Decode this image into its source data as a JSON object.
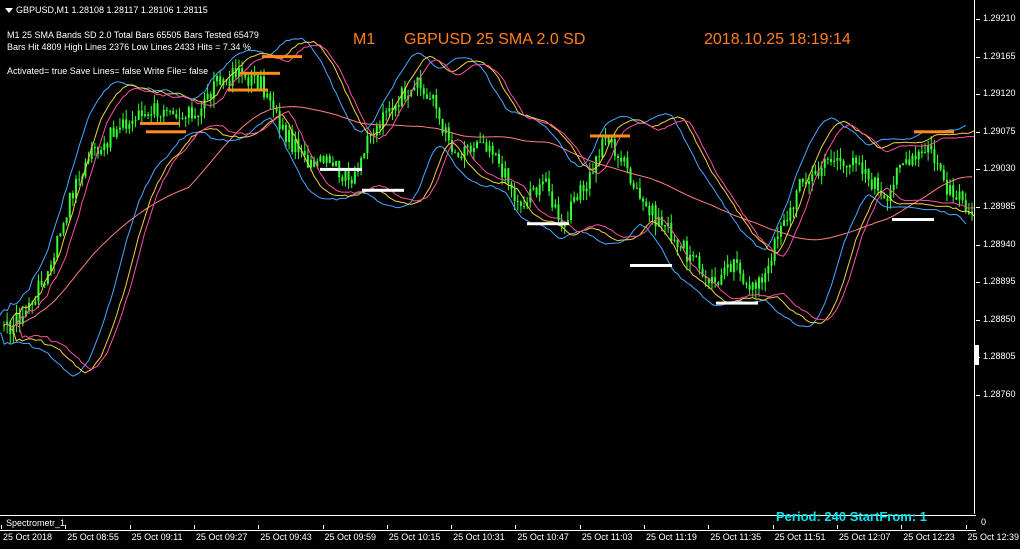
{
  "header": {
    "symbol_line": "GBPUSD,M1  1.28108 1.28117 1.28106 1.28115",
    "info_line1": "M1  25 SMA  Bands SD 2.0  Total Bars 65505  Bars Tested 65479",
    "info_line2": "Bars Hit 4809  High Lines 2376  Low Lines 2433  Hits = 7.34 %",
    "info_line3": "Activated= true  Save Lines= false  Write File= false",
    "banner_timeframe": "M1",
    "banner_title": "GBPUSD  25 SMA  2.0 SD",
    "banner_datetime": "2018.10.25 18:19:14"
  },
  "indicator_window": {
    "label": "Spectrometr_1",
    "info": "Period: 240    StartFrom: 1",
    "scale_label": "0"
  },
  "colors": {
    "background": "#000000",
    "candle": "#33ff33",
    "band_inner": "#ff4fa0",
    "band_mid": "#f4d03f",
    "band_outer": "#44aaff",
    "sma": "#ff7f7f",
    "high_marker": "#ff8c1a",
    "low_marker": "#ffffff",
    "banner_text": "#ff7f1e",
    "indicator_text": "#00e5ee"
  },
  "chart_data": {
    "type": "candlestick",
    "price_axis": [
      "1.29210",
      "1.29165",
      "1.29120",
      "1.29075",
      "1.29030",
      "1.28985",
      "1.28940",
      "1.28895",
      "1.28850",
      "1.28805",
      "1.28760"
    ],
    "time_axis": [
      "25 Oct 2018",
      "25 Oct 08:55",
      "25 Oct 09:11",
      "25 Oct 09:27",
      "25 Oct 09:43",
      "25 Oct 09:59",
      "25 Oct 10:15",
      "25 Oct 10:31",
      "25 Oct 10:47",
      "25 Oct 11:03",
      "25 Oct 11:19",
      "25 Oct 11:35",
      "25 Oct 11:51",
      "25 Oct 12:07",
      "25 Oct 12:23",
      "25 Oct 12:39"
    ],
    "ylim": [
      1.28805,
      1.29235
    ],
    "price_path": [
      1.28835,
      1.2886,
      1.28905,
      1.2899,
      1.2905,
      1.2907,
      1.2909,
      1.29105,
      1.29085,
      1.291,
      1.29135,
      1.29145,
      1.2913,
      1.29075,
      1.2904,
      1.2905,
      1.29015,
      1.29065,
      1.29105,
      1.29135,
      1.2911,
      1.2904,
      1.2906,
      1.2904,
      1.2898,
      1.2902,
      1.28965,
      1.2901,
      1.2907,
      1.2903,
      1.2898,
      1.28955,
      1.2892,
      1.28895,
      1.28915,
      1.28885,
      1.2895,
      1.2901,
      1.29035,
      1.29045,
      1.29025,
      1.29,
      1.29045,
      1.2906,
      1.29,
      1.28985
    ],
    "high_markers": [
      1.29085,
      1.29075,
      1.29125,
      1.29145,
      1.29165,
      1.2907,
      1.29075
    ],
    "low_markers": [
      1.2903,
      1.29005,
      1.28965,
      1.28915,
      1.2887,
      1.2897
    ]
  }
}
